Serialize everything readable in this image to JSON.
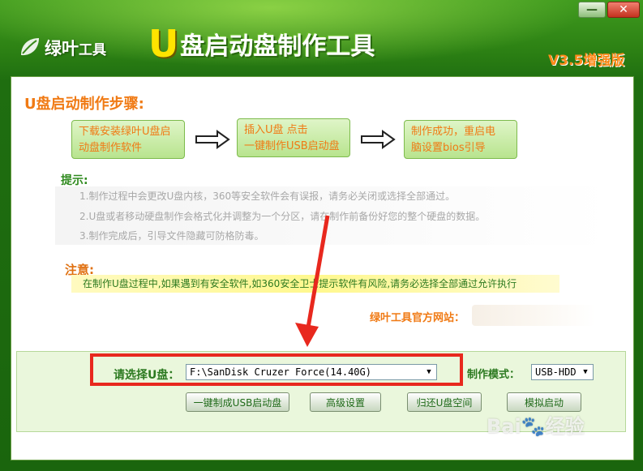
{
  "window": {
    "minimize_label": "—",
    "close_label": "✕"
  },
  "header": {
    "logo_text": "绿叶",
    "logo_text_small": "工具",
    "title_big": "U",
    "title_rest": "盘启动盘制作工具",
    "version": "V3.5增强版"
  },
  "steps": {
    "title": "U盘启动制作步骤:",
    "items": [
      {
        "line1": "下载安装绿叶U盘启",
        "line2": "动盘制作软件"
      },
      {
        "line1": "插入U盘 点击",
        "line2": "一键制作USB启动盘"
      },
      {
        "line1": "制作成功，重启电",
        "line2": "脑设置bios引导"
      }
    ]
  },
  "tips": {
    "label": "提示:",
    "lines": [
      "1.制作过程中会更改U盘内核，360等安全软件会有误报，请务必关闭或选择全部通过。",
      "2.U盘或者移动硬盘制作会格式化并调整为一个分区，请在制作前备份好您的整个硬盘的数据。",
      "3.制作完成后，引导文件隐藏可防格防毒。"
    ]
  },
  "note": {
    "label": "注意:",
    "text": "在制作U盘过程中,如果遇到有安全软件,如360安全卫士提示软件有风险,请务必选择全部通过允许执行"
  },
  "site": {
    "label": "绿叶工具官方网站："
  },
  "controls": {
    "select_label": "请选择U盘：",
    "drive_value": "F:\\SanDisk Cruzer Force(14.40G)",
    "mode_label": "制作模式：",
    "mode_value": "USB-HDD",
    "buttons": {
      "onekey": "一键制成USB启动盘",
      "advanced": "高级设置",
      "restore": "归还U盘空间",
      "simulate": "模拟启动"
    }
  },
  "watermark": {
    "brand": "Bai",
    "brand_suffix": "经验",
    "url": "jingyan.baidu.com"
  },
  "colors": {
    "accent_orange": "#f07a14",
    "green_text": "#2c7a20",
    "highlight_red": "#e8281e"
  }
}
